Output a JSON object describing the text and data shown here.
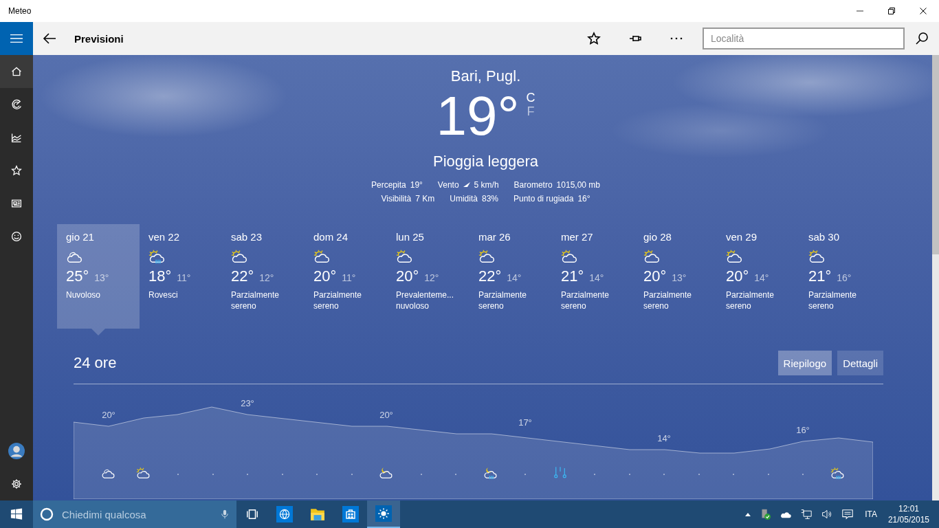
{
  "window": {
    "title": "Meteo"
  },
  "header": {
    "title": "Previsioni",
    "search": {
      "placeholder": "Località"
    }
  },
  "nav": {
    "items": [
      {
        "kind": "home",
        "selected": true
      },
      {
        "kind": "radar",
        "selected": false
      },
      {
        "kind": "chart",
        "selected": false
      },
      {
        "kind": "star",
        "selected": false
      },
      {
        "kind": "news",
        "selected": false
      },
      {
        "kind": "smile",
        "selected": false
      }
    ],
    "bottom": [
      {
        "kind": "avatar"
      },
      {
        "kind": "settings"
      }
    ]
  },
  "current": {
    "city": "Bari, Pugl.",
    "temp": "19°",
    "units": [
      {
        "label": "C",
        "selected": true
      },
      {
        "label": "F",
        "selected": false
      }
    ],
    "condition": "Pioggia leggera",
    "details": [
      [
        {
          "label": "Percepita",
          "value": "19°"
        },
        {
          "label": "Vento",
          "value": "5 km/h",
          "kind": "wind"
        },
        {
          "label": "Barometro",
          "value": "1015,00 mb"
        }
      ],
      [
        {
          "label": "Visibilità",
          "value": "7 Km"
        },
        {
          "label": "Umidità",
          "value": "83%"
        },
        {
          "label": "Punto di rugiada",
          "value": "16°"
        }
      ]
    ]
  },
  "daily": [
    {
      "day": "gio 21",
      "kind": "cloudy",
      "high": "25°",
      "low": "13°",
      "condition": "Nuvoloso",
      "selected": true
    },
    {
      "day": "ven 22",
      "kind": "sun-rain",
      "high": "18°",
      "low": "11°",
      "condition": "Rovesci",
      "selected": false
    },
    {
      "day": "sab 23",
      "kind": "sun-cloud",
      "high": "22°",
      "low": "12°",
      "condition": "Parzialmente sereno",
      "selected": false
    },
    {
      "day": "dom 24",
      "kind": "sun-cloud",
      "high": "20°",
      "low": "11°",
      "condition": "Parzialmente sereno",
      "selected": false
    },
    {
      "day": "lun 25",
      "kind": "sun-cloud",
      "high": "20°",
      "low": "12°",
      "condition": "Prevalenteme... nuvoloso",
      "selected": false
    },
    {
      "day": "mar 26",
      "kind": "sun-cloud",
      "high": "22°",
      "low": "14°",
      "condition": "Parzialmente sereno",
      "selected": false
    },
    {
      "day": "mer 27",
      "kind": "sun-cloud",
      "high": "21°",
      "low": "14°",
      "condition": "Parzialmente sereno",
      "selected": false
    },
    {
      "day": "gio 28",
      "kind": "sun-cloud",
      "high": "20°",
      "low": "13°",
      "condition": "Parzialmente sereno",
      "selected": false
    },
    {
      "day": "ven 29",
      "kind": "sun-cloud",
      "high": "20°",
      "low": "14°",
      "condition": "Parzialmente sereno",
      "selected": false
    },
    {
      "day": "sab 30",
      "kind": "sun-cloud",
      "high": "21°",
      "low": "16°",
      "condition": "Parzialmente sereno",
      "selected": false
    }
  ],
  "hourly": {
    "title": "24 ore",
    "views": [
      {
        "label": "Riepilogo",
        "selected": true
      },
      {
        "label": "Dettagli",
        "selected": false
      }
    ],
    "temp_labels": [
      "20°",
      "23°",
      "20°",
      "17°",
      "14°",
      "16°"
    ],
    "icons": [
      {
        "kind": "cloudy"
      },
      {
        "kind": "sun-cloud"
      },
      {
        "kind": "dot"
      },
      {
        "kind": "dot"
      },
      {
        "kind": "dot"
      },
      {
        "kind": "dot"
      },
      {
        "kind": "dot"
      },
      {
        "kind": "dot"
      },
      {
        "kind": "moon-cloud"
      },
      {
        "kind": "dot"
      },
      {
        "kind": "dot"
      },
      {
        "kind": "moon-rain"
      },
      {
        "kind": "dot"
      },
      {
        "kind": "drops"
      },
      {
        "kind": "dot"
      },
      {
        "kind": "dot"
      },
      {
        "kind": "dot"
      },
      {
        "kind": "dot"
      },
      {
        "kind": "dot"
      },
      {
        "kind": "dot"
      },
      {
        "kind": "dot"
      },
      {
        "kind": "sun-rain"
      }
    ]
  },
  "taskbar": {
    "search": {
      "placeholder": "Chiedimi qualcosa"
    },
    "apps": [
      {
        "kind": "task-view",
        "active": false
      },
      {
        "kind": "browser",
        "active": false
      },
      {
        "kind": "folder",
        "active": false
      },
      {
        "kind": "store",
        "active": false
      },
      {
        "kind": "weather",
        "active": true
      }
    ],
    "tray": {
      "language": "ITA",
      "time": "12:01",
      "date": "21/05/2015"
    }
  }
}
